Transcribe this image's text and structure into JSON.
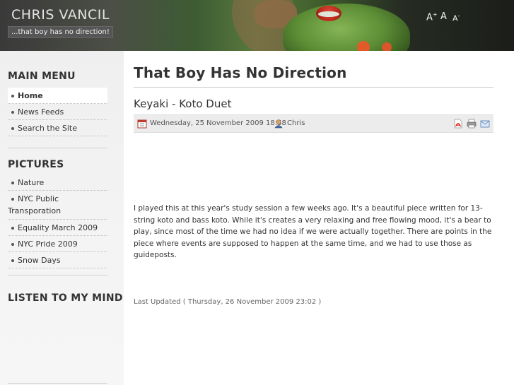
{
  "site": {
    "title": "CHRIS VANCIL",
    "slogan": "...that boy has no direction!"
  },
  "font_tools": {
    "increase": "A",
    "increase_mark": "+",
    "reset": "A",
    "decrease": "A",
    "decrease_mark": "-"
  },
  "sidebar": {
    "main_menu_title": "MAIN MENU",
    "main_menu": [
      {
        "label": "Home",
        "active": true
      },
      {
        "label": "News Feeds"
      },
      {
        "label": "Search the Site"
      }
    ],
    "pictures_title": "PICTURES",
    "pictures": [
      {
        "label": "Nature"
      },
      {
        "label": "NYC Public",
        "label_line2": "Transporation"
      },
      {
        "label": "Equality March 2009"
      },
      {
        "label": "NYC Pride 2009"
      },
      {
        "label": "Snow Days"
      }
    ],
    "listen_title": "LISTEN TO MY MIND"
  },
  "main": {
    "heading": "That Boy Has No Direction",
    "article": {
      "title": "Keyaki - Koto Duet",
      "date": "Wednesday, 25 November 2009 18:58",
      "author": "Chris",
      "body": "I played this at this year's study session a few weeks ago. It's a beautiful piece written for 13-string koto and bass koto. While it's creates a very relaxing and free flowing mood, it's a bear to play, since most of the time we had no idea if we were actually together. There are points in the piece where events are supposed to happen at the same time, and we had to use those as guideposts.",
      "last_updated": "Last Updated ( Thursday, 26 November 2009 23:02 )"
    }
  },
  "icons": [
    "calendar-icon",
    "author-icon",
    "pdf-icon",
    "print-icon",
    "email-icon"
  ],
  "colors": {
    "header_dark": "#2a2a2a",
    "sidebar_bg": "#f1f1f1",
    "text": "#333333",
    "info_bar": "#ececec"
  }
}
